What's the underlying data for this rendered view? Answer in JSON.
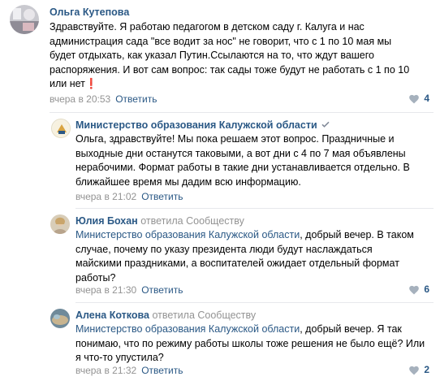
{
  "comments": [
    {
      "author": "Ольга Кутепова",
      "text": "Здравствуйте. Я работаю педагогом в детском саду г. Калуга и нас администрация сада \"все водит за нос\" не говорит, что с 1 по 10 мая мы будет отдыхать, как указал Путин.Ссылаются на то, что ждут вашего распоряжения. И вот сам вопрос: так сады тоже будут не работать с 1 по 10 или нет",
      "text_suffix": "❗️",
      "time": "вчера в 20:53",
      "reply_label": "Ответить",
      "likes": "4"
    },
    {
      "author": "Министерство образования Калужской области",
      "verified": true,
      "text": "Ольга, здравствуйте! Мы пока решаем этот вопрос. Праздничные и выходные дни останутся таковыми, а вот дни с 4 по 7 мая объявлены нерабочими. Формат работы в такие дни устанавливается отдельно. В ближайшее время мы дадим всю информацию.",
      "time": "вчера в 21:02",
      "reply_label": "Ответить",
      "likes": ""
    },
    {
      "author": "Юлия Бохан",
      "replied_to": "ответила Сообществу",
      "mention": "Министерство образования Калужской области",
      "text": ", добрый вечер. В таком случае, почему по указу президента люди будут наслаждаться майскими праздниками, а воспитателей ожидает отдельный формат работы?",
      "time": "вчера в 21:30",
      "reply_label": "Ответить",
      "likes": "6"
    },
    {
      "author": "Алена Коткова",
      "replied_to": "ответила Сообществу",
      "mention": "Министерство образования Калужской области",
      "text": ", добрый вечер. Я так понимаю, что по режиму работы школы тоже решения не было ещё? Или я что-то упустила?",
      "time": "вчера в 21:32",
      "reply_label": "Ответить",
      "likes": "2"
    }
  ],
  "colors": {
    "link": "#2a5885",
    "meta": "#939393",
    "divider": "#e7e8ec",
    "like_icon": "#a6b1bd"
  }
}
